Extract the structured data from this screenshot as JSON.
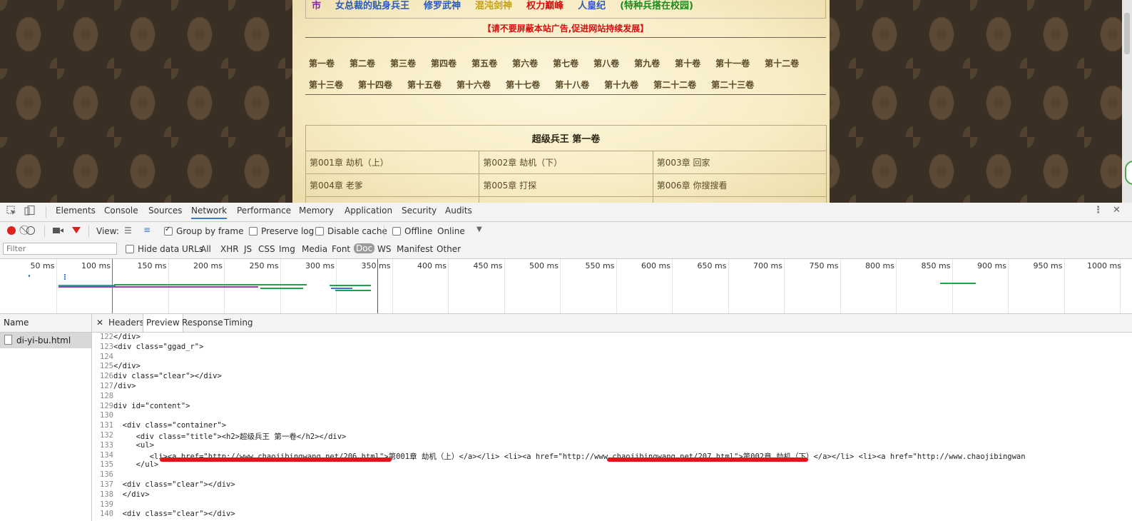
{
  "webpage": {
    "top_nav": [
      {
        "text": "市",
        "color": "#8a1fb8"
      },
      {
        "text": "女总裁的贴身兵王",
        "color": "#2a5ab8"
      },
      {
        "text": "修罗武神",
        "color": "#2a5ab8"
      },
      {
        "text": "混沌剑神",
        "color": "#c4a012"
      },
      {
        "text": "权力巅峰",
        "color": "#d41010"
      },
      {
        "text": "人皇纪",
        "color": "#2a5ab8"
      },
      {
        "text": "(特种兵搭在校园)",
        "color": "#1a8a1a"
      }
    ],
    "ad_notice": "【请不要屏蔽本站广告,促进网站持续发展】",
    "volumes_row1": [
      "第一卷",
      "第二卷",
      "第三卷",
      "第四卷",
      "第五卷",
      "第六卷",
      "第七卷",
      "第八卷",
      "第九卷",
      "第十卷",
      "第十一卷",
      "第十二卷"
    ],
    "volumes_row2": [
      "第十三卷",
      "第十四卷",
      "第十五卷",
      "第十六卷",
      "第十七卷",
      "第十八卷",
      "第十九卷",
      "第二十二卷",
      "第二十三卷"
    ],
    "chapter_table": {
      "title": "超级兵王 第一卷",
      "rows": [
        [
          "第001章 劫机（上）",
          "第002章 劫机（下）",
          "第003章 回家"
        ],
        [
          "第004章 老爹",
          "第005章 打探",
          "第006章 你搜搜看"
        ]
      ]
    }
  },
  "devtools": {
    "tabs": [
      "Elements",
      "Console",
      "Sources",
      "Network",
      "Performance",
      "Memory",
      "Application",
      "Security",
      "Audits"
    ],
    "active_tab": "Network",
    "toolbar": {
      "view_label": "View:",
      "group_by_frame": "Group by frame",
      "preserve_log": "Preserve log",
      "disable_cache": "Disable cache",
      "offline": "Offline",
      "throttle": "Online"
    },
    "filter": {
      "placeholder": "Filter",
      "hide_data_urls": "Hide data URLs",
      "types": [
        "All",
        "XHR",
        "JS",
        "CSS",
        "Img",
        "Media",
        "Font",
        "Doc",
        "WS",
        "Manifest",
        "Other"
      ],
      "active_type": "Doc"
    },
    "timeline_ticks": [
      "50 ms",
      "100 ms",
      "150 ms",
      "200 ms",
      "250 ms",
      "300 ms",
      "350 ms",
      "400 ms",
      "450 ms",
      "500 ms",
      "550 ms",
      "600 ms",
      "650 ms",
      "700 ms",
      "750 ms",
      "800 ms",
      "850 ms",
      "900 ms",
      "950 ms",
      "1000 ms"
    ],
    "name_header": "Name",
    "requests": [
      "di-yi-bu.html"
    ],
    "detail_tabs": [
      "Headers",
      "Preview",
      "Response",
      "Timing"
    ],
    "active_detail_tab": "Preview",
    "code_lines": [
      {
        "n": "122",
        "text": "</div>"
      },
      {
        "n": "123",
        "text": "<div class=\"ggad_r\">"
      },
      {
        "n": "124",
        "text": ""
      },
      {
        "n": "125",
        "text": "</div>"
      },
      {
        "n": "126",
        "text": "div class=\"clear\"></div>"
      },
      {
        "n": "127",
        "text": "/div>"
      },
      {
        "n": "128",
        "text": ""
      },
      {
        "n": "129",
        "text": "div id=\"content\">"
      },
      {
        "n": "130",
        "text": ""
      },
      {
        "n": "131",
        "text": "  <div class=\"container\">"
      },
      {
        "n": "132",
        "text": "     <div class=\"title\"><h2>超级兵王 第一卷</h2></div>"
      },
      {
        "n": "133",
        "text": "     <ul>"
      },
      {
        "n": "134",
        "text": "        <li><a href=\"http://www.chaojibingwang.net/206.html\">第001章 劫机（上）</a></li> <li><a href=\"http://www.chaojibingwang.net/207.html\">第002章 劫机（下）</a></li> <li><a href=\"http://www.chaojibingwan"
      },
      {
        "n": "135",
        "text": "     </ul>"
      },
      {
        "n": "136",
        "text": ""
      },
      {
        "n": "137",
        "text": "  <div class=\"clear\"></div>"
      },
      {
        "n": "138",
        "text": "  </div>"
      },
      {
        "n": "139",
        "text": ""
      },
      {
        "n": "140",
        "text": "  <div class=\"clear\"></div>"
      }
    ]
  }
}
